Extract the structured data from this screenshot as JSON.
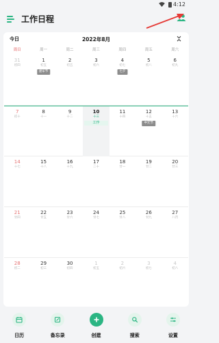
{
  "status_bar": {
    "time": "4:12"
  },
  "header": {
    "title": "工作日程"
  },
  "calendar": {
    "today_label": "今日",
    "month": "2022年8月",
    "weekdays": [
      "周日",
      "周一",
      "周二",
      "周三",
      "周四",
      "周五",
      "周六"
    ],
    "weeks": [
      {
        "days": [
          {
            "num": "31",
            "lunar": "初四",
            "dim": true
          },
          {
            "num": "1",
            "lunar": "初五",
            "holiday": "建军节"
          },
          {
            "num": "2",
            "lunar": "初五"
          },
          {
            "num": "3",
            "lunar": "初六"
          },
          {
            "num": "4",
            "lunar": "初七",
            "holiday": "七夕"
          },
          {
            "num": "5",
            "lunar": "初八"
          },
          {
            "num": "6",
            "lunar": "初九"
          }
        ]
      },
      {
        "days": [
          {
            "num": "7",
            "lunar": "初十"
          },
          {
            "num": "8",
            "lunar": "十一"
          },
          {
            "num": "9",
            "lunar": "十二"
          },
          {
            "num": "10",
            "lunar": "十三",
            "today": true,
            "event": "工作"
          },
          {
            "num": "11",
            "lunar": "十四"
          },
          {
            "num": "12",
            "lunar": "十五",
            "holiday": "中元节"
          },
          {
            "num": "13",
            "lunar": "十六"
          }
        ]
      },
      {
        "days": [
          {
            "num": "14",
            "lunar": "十七"
          },
          {
            "num": "15",
            "lunar": "十八"
          },
          {
            "num": "16",
            "lunar": "十九"
          },
          {
            "num": "17",
            "lunar": "二十"
          },
          {
            "num": "18",
            "lunar": "廿一"
          },
          {
            "num": "19",
            "lunar": "廿二"
          },
          {
            "num": "20",
            "lunar": "廿三"
          }
        ]
      },
      {
        "days": [
          {
            "num": "21",
            "lunar": "廿四"
          },
          {
            "num": "22",
            "lunar": "廿五"
          },
          {
            "num": "23",
            "lunar": "廿六"
          },
          {
            "num": "24",
            "lunar": "廿七"
          },
          {
            "num": "25",
            "lunar": "廿八"
          },
          {
            "num": "26",
            "lunar": "廿九"
          },
          {
            "num": "27",
            "lunar": "八月"
          }
        ]
      },
      {
        "days": [
          {
            "num": "28",
            "lunar": "初二"
          },
          {
            "num": "29",
            "lunar": "初三"
          },
          {
            "num": "30",
            "lunar": "初四"
          },
          {
            "num": "1",
            "lunar": "初五",
            "dim": true
          },
          {
            "num": "2",
            "lunar": "初六",
            "dim": true
          },
          {
            "num": "3",
            "lunar": "初七",
            "dim": true
          },
          {
            "num": "4",
            "lunar": "初八",
            "dim": true
          }
        ]
      }
    ]
  },
  "nav": [
    {
      "label": "日历",
      "icon": "calendar-icon"
    },
    {
      "label": "备忘录",
      "icon": "memo-icon"
    },
    {
      "label": "创建",
      "icon": "plus-icon",
      "primary": true
    },
    {
      "label": "搜索",
      "icon": "search-icon"
    },
    {
      "label": "设置",
      "icon": "settings-icon"
    }
  ],
  "colors": {
    "accent": "#2bb583",
    "weekend": "#e57373",
    "holiday_bg": "#8c8c8c",
    "annotation": "#e53935"
  }
}
